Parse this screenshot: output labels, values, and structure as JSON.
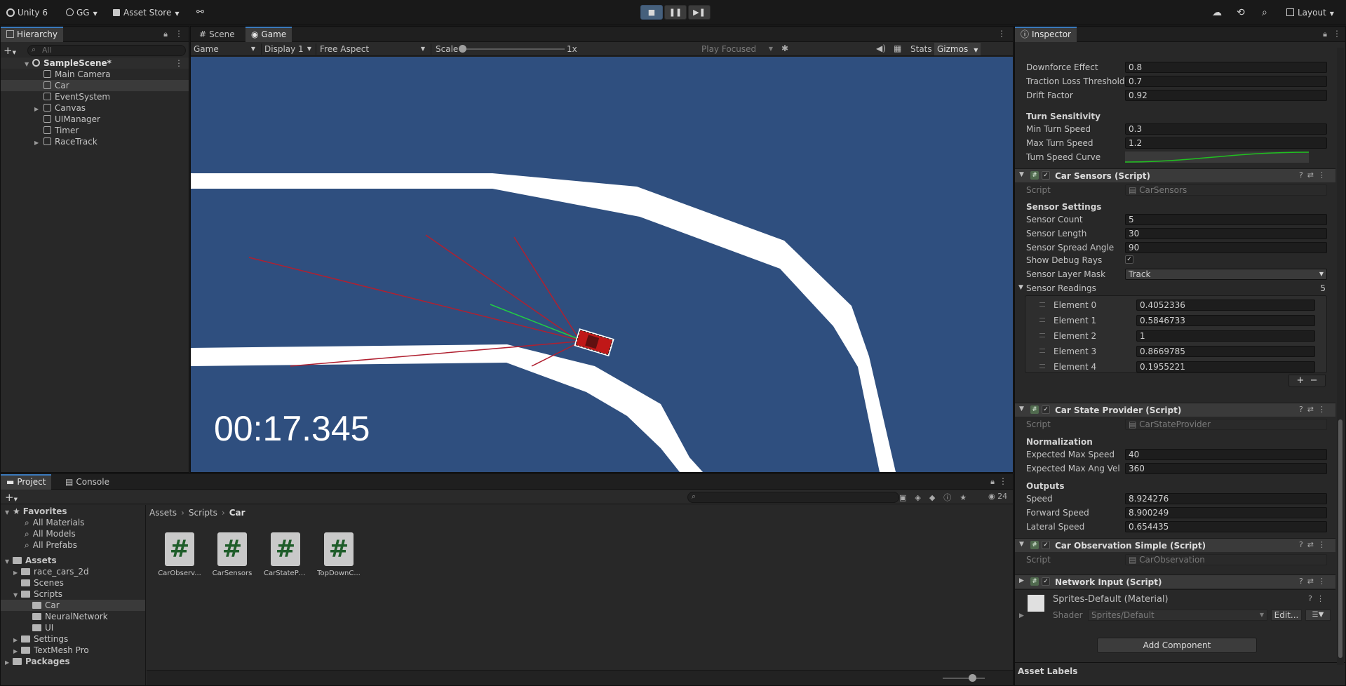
{
  "toolbar": {
    "app": "Unity 6",
    "account": "GG",
    "asset_store": "Asset Store",
    "layout": "Layout"
  },
  "hierarchy": {
    "tab": "Hierarchy",
    "search_placeholder": "All",
    "scene": "SampleScene*",
    "items": [
      "Main Camera",
      "Car",
      "EventSystem",
      "Canvas",
      "UIManager",
      "Timer",
      "RaceTrack"
    ]
  },
  "scene_tabs": {
    "scene": "Scene",
    "game": "Game"
  },
  "game_toolbar": {
    "mode": "Game",
    "display": "Display 1",
    "aspect": "Free Aspect",
    "scale_label": "Scale",
    "scale_value": "1x",
    "play_focused": "Play Focused",
    "stats": "Stats",
    "gizmos": "Gizmos"
  },
  "game_view": {
    "timer": "00:17.345",
    "background": "#2f4f7f",
    "track_color": "#ffffff",
    "ray_color": "#b02030",
    "ray_green": "#22cc44"
  },
  "inspector": {
    "tab": "Inspector",
    "top_fields": [
      {
        "label": "Downforce Effect",
        "value": "0.8"
      },
      {
        "label": "Traction Loss Threshold",
        "value": "0.7"
      },
      {
        "label": "Drift Factor",
        "value": "0.92"
      }
    ],
    "turn_header": "Turn Sensitivity",
    "turn_fields": [
      {
        "label": "Min Turn Speed",
        "value": "0.3"
      },
      {
        "label": "Max Turn Speed",
        "value": "1.2"
      }
    ],
    "turn_curve_label": "Turn Speed Curve",
    "sensors": {
      "title": "Car Sensors (Script)",
      "script_label": "Script",
      "script_value": "CarSensors",
      "settings_header": "Sensor Settings",
      "fields": [
        {
          "label": "Sensor Count",
          "value": "5"
        },
        {
          "label": "Sensor Length",
          "value": "30"
        },
        {
          "label": "Sensor Spread Angle",
          "value": "90"
        }
      ],
      "debug_label": "Show Debug Rays",
      "mask_label": "Sensor Layer Mask",
      "mask_value": "Track",
      "readings_label": "Sensor Readings",
      "readings_count": "5",
      "readings": [
        {
          "label": "Element 0",
          "value": "0.4052336"
        },
        {
          "label": "Element 1",
          "value": "0.5846733"
        },
        {
          "label": "Element 2",
          "value": "1"
        },
        {
          "label": "Element 3",
          "value": "0.8669785"
        },
        {
          "label": "Element 4",
          "value": "0.1955221"
        }
      ]
    },
    "state": {
      "title": "Car State Provider (Script)",
      "script_label": "Script",
      "script_value": "CarStateProvider",
      "norm_header": "Normalization",
      "norm_fields": [
        {
          "label": "Expected Max Speed",
          "value": "40"
        },
        {
          "label": "Expected Max Ang Vel",
          "value": "360"
        }
      ],
      "outputs_header": "Outputs",
      "outputs": [
        {
          "label": "Speed",
          "value": "8.924276"
        },
        {
          "label": "Forward Speed",
          "value": "8.900249"
        },
        {
          "label": "Lateral Speed",
          "value": "0.654435"
        }
      ]
    },
    "observation": {
      "title": "Car Observation Simple (Script)",
      "script_label": "Script",
      "script_value": "CarObservation"
    },
    "network": {
      "title": "Network Input (Script)"
    },
    "material": {
      "title": "Sprites-Default (Material)",
      "shader_label": "Shader",
      "shader_value": "Sprites/Default",
      "edit": "Edit..."
    },
    "add_component": "Add Component",
    "asset_labels": "Asset Labels"
  },
  "project": {
    "tab_project": "Project",
    "tab_console": "Console",
    "count": "24",
    "favorites": {
      "label": "Favorites",
      "items": [
        "All Materials",
        "All Models",
        "All Prefabs"
      ]
    },
    "assets_label": "Assets",
    "tree": [
      "race_cars_2d",
      "Scenes",
      "Scripts",
      "Car",
      "NeuralNetwork",
      "UI",
      "Settings",
      "TextMesh Pro"
    ],
    "packages": "Packages",
    "breadcrumb": [
      "Assets",
      "Scripts",
      "Car"
    ],
    "files": [
      {
        "name": "CarObserv...",
        "glyph": "#"
      },
      {
        "name": "CarSensors",
        "glyph": "#"
      },
      {
        "name": "CarStatePr...",
        "glyph": "#"
      },
      {
        "name": "TopDownC...",
        "glyph": "#"
      }
    ]
  }
}
